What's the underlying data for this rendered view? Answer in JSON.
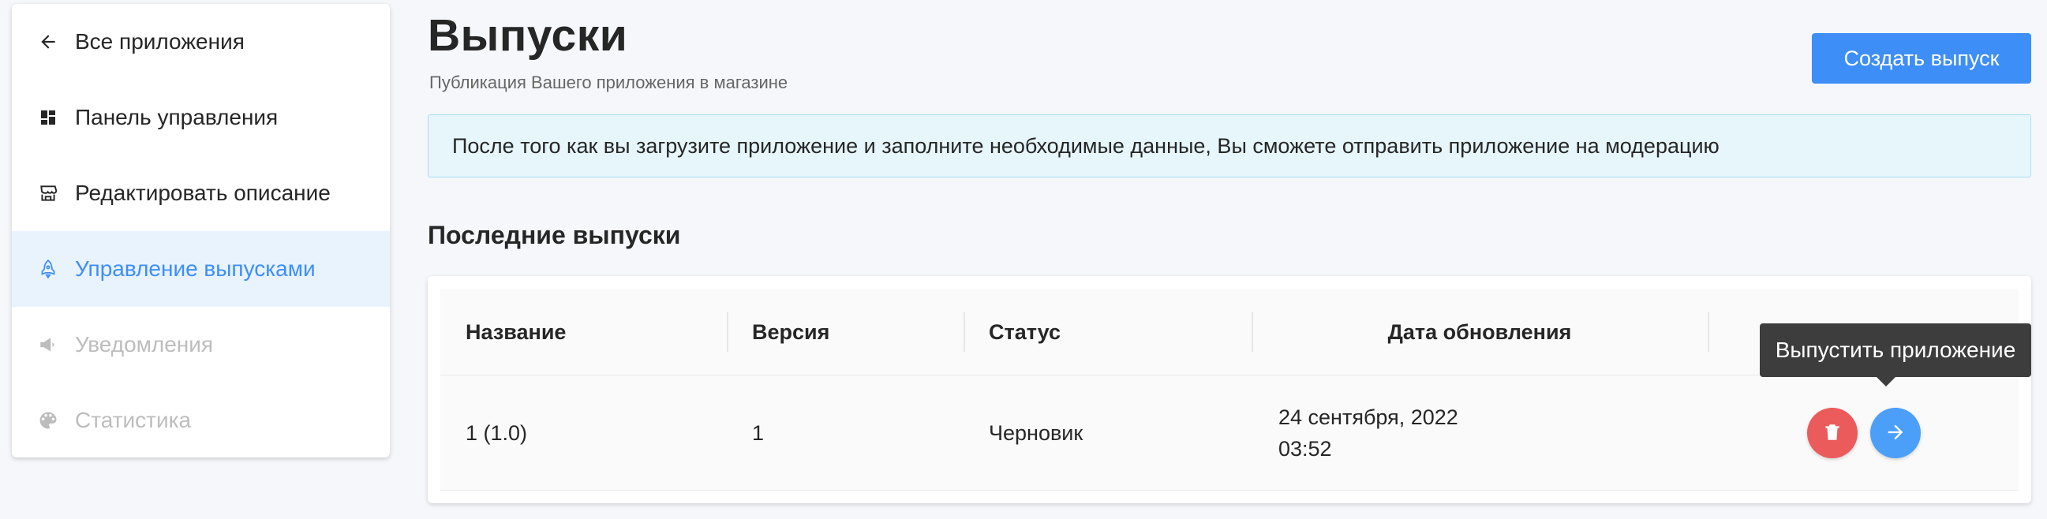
{
  "sidebar": {
    "items": [
      {
        "label": "Все приложения",
        "icon": "arrow-left-icon",
        "state": "normal"
      },
      {
        "label": "Панель управления",
        "icon": "dashboard-grid-icon",
        "state": "normal"
      },
      {
        "label": "Редактировать описание",
        "icon": "storefront-icon",
        "state": "normal"
      },
      {
        "label": "Управление выпусками",
        "icon": "rocket-icon",
        "state": "active"
      },
      {
        "label": "Уведомления",
        "icon": "megaphone-icon",
        "state": "disabled"
      },
      {
        "label": "Статистика",
        "icon": "palette-icon",
        "state": "disabled"
      }
    ]
  },
  "header": {
    "title": "Выпуски",
    "subtitle": "Публикация Вашего приложения в магазине",
    "create_button": "Создать выпуск"
  },
  "info": {
    "text": "После того как вы загрузите приложение и заполните необходимые данные, Вы сможете отправить приложение на модерацию"
  },
  "releases": {
    "title": "Последние выпуски",
    "columns": [
      "Название",
      "Версия",
      "Статус",
      "Дата обновления"
    ],
    "rows": [
      {
        "name": "1 (1.0)",
        "version": "1",
        "status": "Черновик",
        "date": "24 сентября, 2022",
        "time": "03:52"
      }
    ]
  },
  "tooltip": {
    "text": "Выпустить приложение"
  },
  "colors": {
    "accent": "#3e8ef7",
    "active_bg": "#e8f3fe",
    "info_bg": "#e6f6fb",
    "info_border": "#a9dff0",
    "delete": "#ec5b5b",
    "tooltip_bg": "#3d3d3d",
    "disabled_text": "#bdbdbd"
  }
}
